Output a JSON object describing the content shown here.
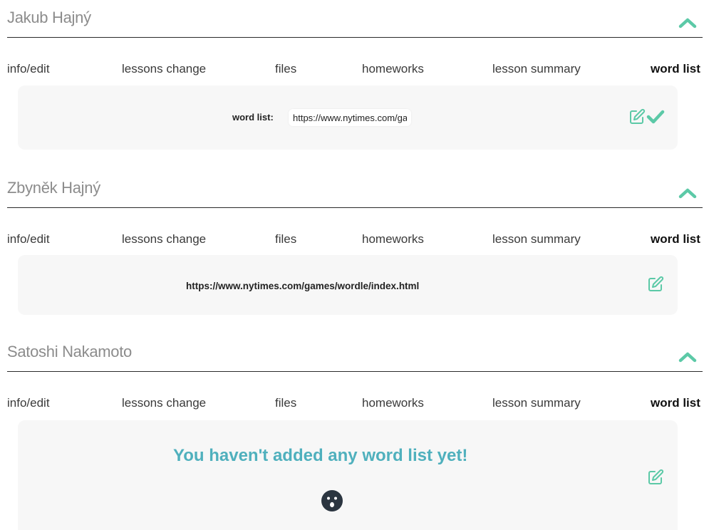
{
  "tabs": [
    "info/edit",
    "lessons change",
    "files",
    "homeworks",
    "lesson summary",
    "word list"
  ],
  "students": [
    {
      "name": "Jakub Hajný",
      "panel": {
        "mode": "editing",
        "label": "word list:",
        "input_value": "https://www.nytimes.com/games/wordle/index.html"
      }
    },
    {
      "name": "Zbyněk Hajný",
      "panel": {
        "mode": "display",
        "url": "https://www.nytimes.com/games/wordle/index.html"
      }
    },
    {
      "name": "Satoshi Nakamoto",
      "panel": {
        "mode": "empty",
        "message": "You haven't added any word list yet!"
      }
    }
  ],
  "colors": {
    "accent": "#5cc9a7",
    "empty_text": "#4fb0bd",
    "panel_bg": "#f7f7f7",
    "face": "#2b3540"
  }
}
